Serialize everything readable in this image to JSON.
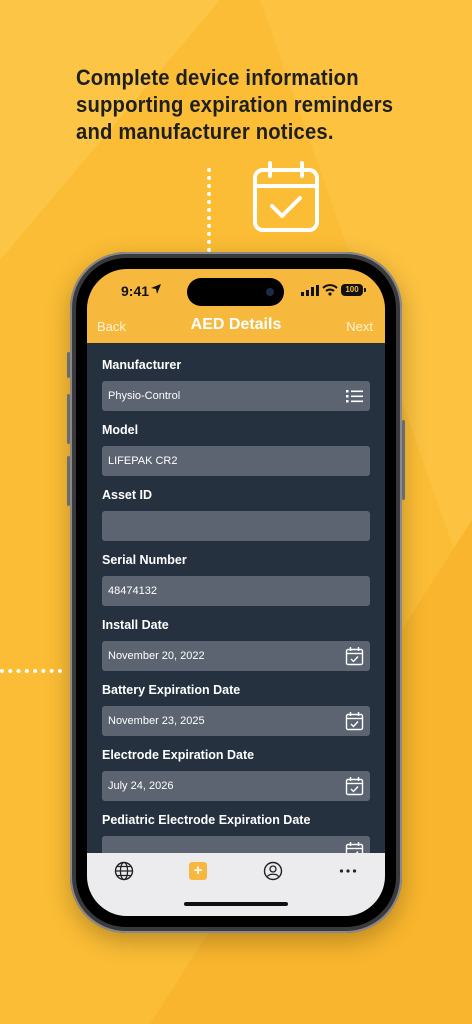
{
  "headline": {
    "lines": [
      "Complete device information",
      "supporting expiration reminders",
      "and manufacturer notices."
    ]
  },
  "status_bar": {
    "time": "9:41",
    "battery": "100"
  },
  "nav": {
    "back_label": "Back",
    "title": "AED Details",
    "next_label": "Next"
  },
  "form": {
    "fields": [
      {
        "label": "Manufacturer",
        "value": "Physio-Control",
        "icon": "list-icon"
      },
      {
        "label": "Model",
        "value": "LIFEPAK CR2",
        "icon": ""
      },
      {
        "label": "Asset ID",
        "value": "",
        "icon": ""
      },
      {
        "label": "Serial Number",
        "value": "48474132",
        "icon": ""
      },
      {
        "label": "Install Date",
        "value": "November 20, 2022",
        "icon": "calendar-icon"
      },
      {
        "label": "Battery Expiration Date",
        "value": "November 23, 2025",
        "icon": "calendar-icon"
      },
      {
        "label": "Electrode Expiration Date",
        "value": "July 24, 2026",
        "icon": "calendar-icon"
      },
      {
        "label": "Pediatric Electrode Expiration Date",
        "value": "",
        "icon": "calendar-icon"
      }
    ]
  },
  "tab_bar": {
    "items": [
      {
        "icon": "globe-icon"
      },
      {
        "icon": "add-icon",
        "label": "+"
      },
      {
        "icon": "profile-icon"
      },
      {
        "icon": "more-icon"
      }
    ]
  },
  "colors": {
    "background": "#fbbd35",
    "accent": "#f6b93e",
    "screen": "#263140",
    "field": "#5b6470"
  }
}
